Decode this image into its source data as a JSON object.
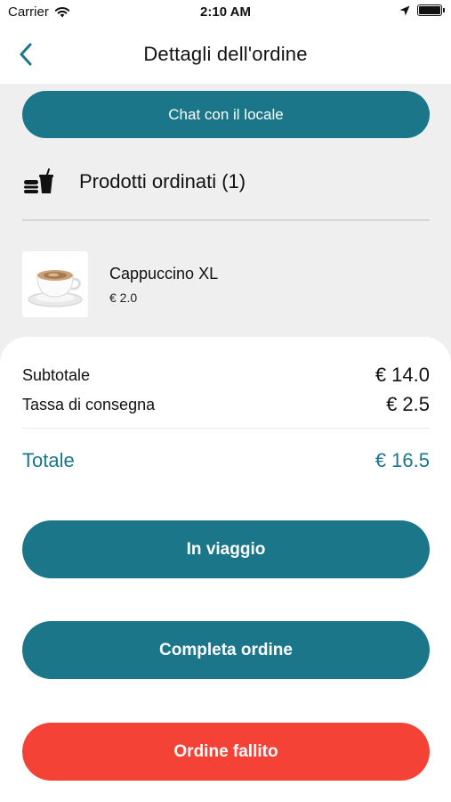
{
  "status_bar": {
    "carrier": "Carrier",
    "time": "2:10 AM"
  },
  "nav": {
    "title": "Dettagli dell'ordine"
  },
  "chat_button": {
    "label": "Chat con il locale"
  },
  "products": {
    "title": "Prodotti ordinati (1)",
    "items": [
      {
        "name": "Cappuccino XL",
        "price": "€ 2.0"
      }
    ]
  },
  "summary": {
    "subtotal_label": "Subtotale",
    "subtotal_value": "€ 14.0",
    "delivery_label": "Tassa di consegna",
    "delivery_value": "€ 2.5",
    "total_label": "Totale",
    "total_value": "€ 16.5"
  },
  "actions": {
    "in_transit": "In viaggio",
    "complete": "Completa ordine",
    "failed": "Ordine fallito"
  },
  "colors": {
    "accent": "#1b7689",
    "danger": "#f44336",
    "background": "#efefef"
  }
}
